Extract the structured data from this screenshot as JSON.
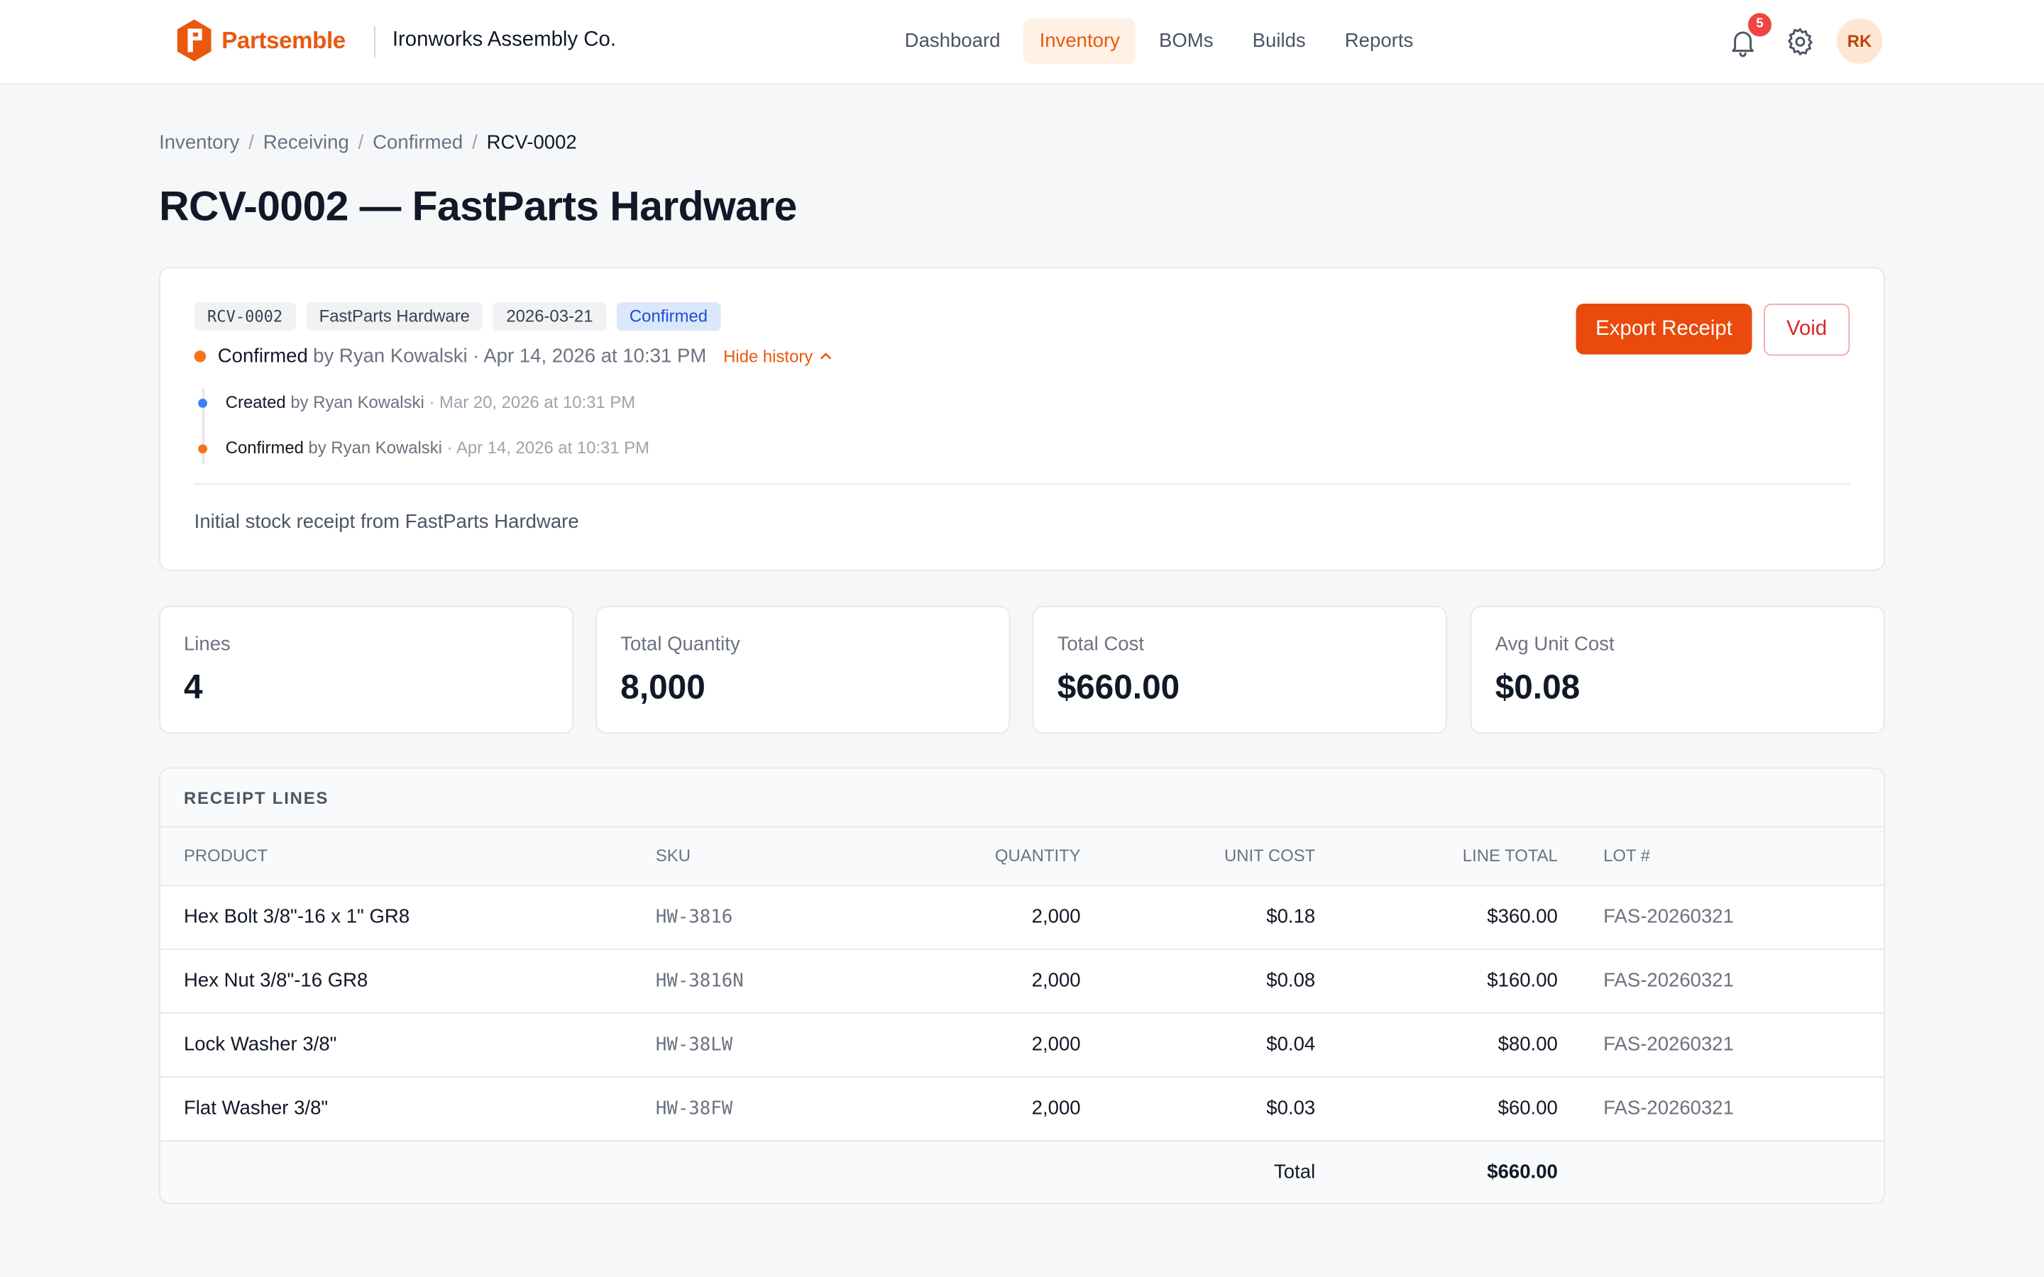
{
  "app": {
    "brand": "Partsemble",
    "org": "Ironworks Assembly Co.",
    "nav": [
      "Dashboard",
      "Inventory",
      "BOMs",
      "Builds",
      "Reports"
    ],
    "notifications": "5",
    "user_initials": "RK",
    "brand_color": "#ea580c"
  },
  "breadcrumb": [
    "Inventory",
    "Receiving",
    "Confirmed",
    "RCV-0002"
  ],
  "page_title": "RCV-0002 — FastParts Hardware",
  "receipt": {
    "tags": {
      "id": "RCV-0002",
      "vendor": "FastParts Hardware",
      "date": "2026-03-21",
      "status": "Confirmed"
    },
    "status_line": {
      "status": "Confirmed",
      "by": "by Ryan Kowalski",
      "when": "· Apr 14, 2026 at 10:31 PM",
      "toggle": "Hide history"
    },
    "history": [
      {
        "action": "Created",
        "by": "by Ryan Kowalski",
        "when": "· Mar 20, 2026 at 10:31 PM",
        "dot": "#3b82f6"
      },
      {
        "action": "Confirmed",
        "by": "by Ryan Kowalski",
        "when": "· Apr 14, 2026 at 10:31 PM",
        "dot": "#f97316"
      }
    ],
    "notes": "Initial stock receipt from FastParts Hardware",
    "export_label": "Export Receipt",
    "void_label": "Void"
  },
  "stats": [
    {
      "label": "Lines",
      "value": "4"
    },
    {
      "label": "Total Quantity",
      "value": "8,000"
    },
    {
      "label": "Total Cost",
      "value": "$660.00"
    },
    {
      "label": "Avg Unit Cost",
      "value": "$0.08"
    }
  ],
  "lines": {
    "title": "RECEIPT LINES",
    "columns": [
      "PRODUCT",
      "SKU",
      "QUANTITY",
      "UNIT COST",
      "LINE TOTAL",
      "LOT #"
    ],
    "rows": [
      [
        "Hex Bolt 3/8\"-16 x 1\" GR8",
        "HW-3816",
        "2,000",
        "$0.18",
        "$360.00",
        "FAS-20260321"
      ],
      [
        "Hex Nut 3/8\"-16 GR8",
        "HW-3816N",
        "2,000",
        "$0.08",
        "$160.00",
        "FAS-20260321"
      ],
      [
        "Lock Washer 3/8\"",
        "HW-38LW",
        "2,000",
        "$0.04",
        "$80.00",
        "FAS-20260321"
      ],
      [
        "Flat Washer 3/8\"",
        "HW-38FW",
        "2,000",
        "$0.03",
        "$60.00",
        "FAS-20260321"
      ]
    ],
    "total_label": "Total",
    "total_value": "$660.00"
  }
}
